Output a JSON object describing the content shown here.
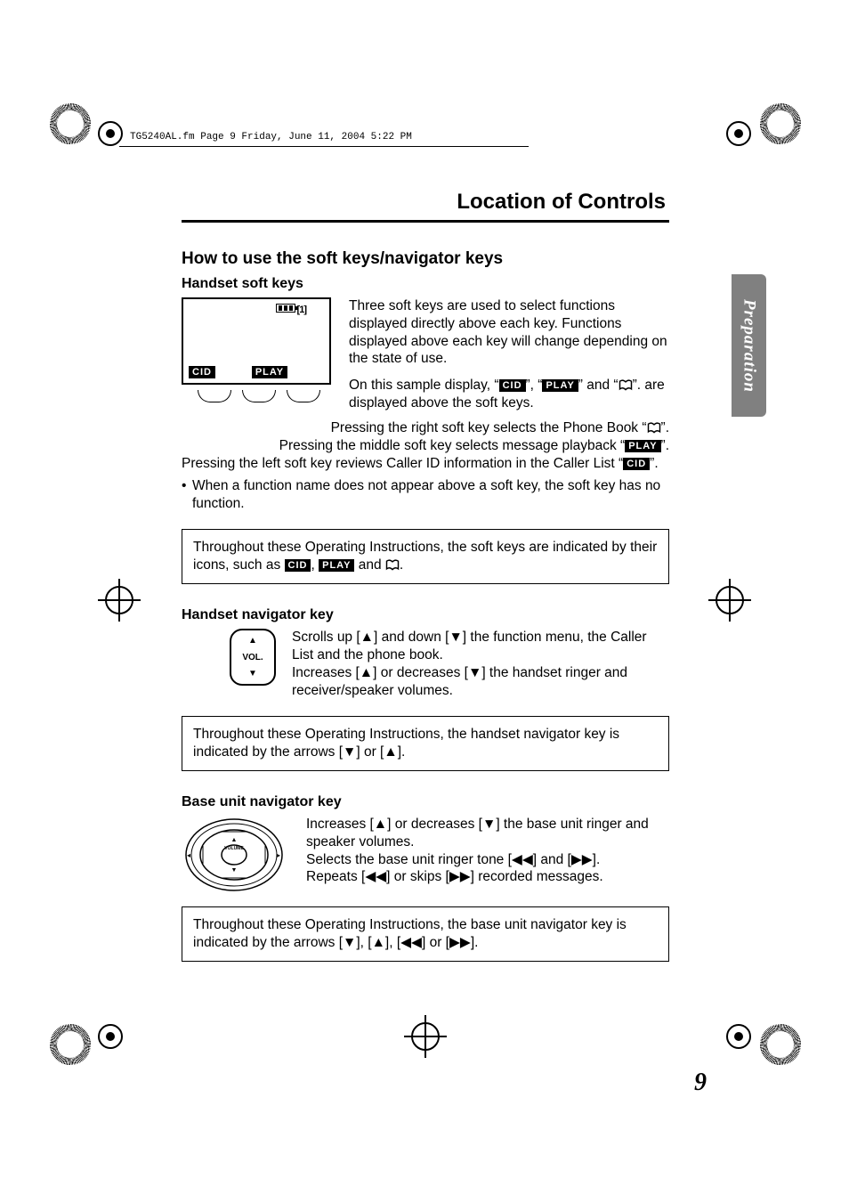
{
  "print_header": "TG5240AL.fm  Page 9  Friday, June 11, 2004  5:22 PM",
  "section_title": "Location of Controls",
  "tab_label": "Preparation",
  "page_number": "9",
  "h2": "How to use the soft keys/navigator keys",
  "handset": {
    "h3": "Handset soft keys",
    "lcd_batt_label": "[1]",
    "lcd_cid": "CID",
    "lcd_play": "PLAY",
    "p1": "Three soft keys are used to select functions displayed directly above each key. Functions displayed above each key will change depending on the state of use.",
    "p2a": "On this sample display, “",
    "p2b": "”, “",
    "p2c": "” and “",
    "p2d": "”. are displayed above the soft keys.",
    "p3a": "Pressing the right soft key selects the Phone Book “",
    "p3b": "”.",
    "p4a": "Pressing the middle soft key selects message playback “",
    "p4b": "”.",
    "p5a": "Pressing the left soft key reviews Caller ID information in the Caller List “",
    "p5b": "”.",
    "bullet1": "When a function name does not appear above a soft key, the soft key has no function.",
    "note1a": "Throughout these Operating Instructions, the soft keys are indicated by their icons, such as ",
    "note1b": ", ",
    "note1c": " and ",
    "note1d": "."
  },
  "nav": {
    "h3": "Handset navigator key",
    "vol_label": "VOL.",
    "p1": "Scrolls up [▲] and down [▼] the function menu, the Caller List and the phone book.",
    "p2": "Increases [▲] or decreases [▼] the handset ringer and receiver/speaker volumes.",
    "note": "Throughout these Operating Instructions, the handset navigator key is indicated by the arrows [▼] or [▲]."
  },
  "base": {
    "h3": "Base unit navigator key",
    "vol_label": "VOLUME",
    "p1": "Increases [▲] or decreases [▼] the base unit ringer and speaker volumes.",
    "p2": "Selects the base unit ringer tone [◀◀] and [▶▶].",
    "p3": "Repeats [◀◀] or skips [▶▶] recorded messages.",
    "note": "Throughout these Operating Instructions, the base unit navigator key is indicated by the arrows [▼], [▲], [◀◀] or [▶▶]."
  }
}
